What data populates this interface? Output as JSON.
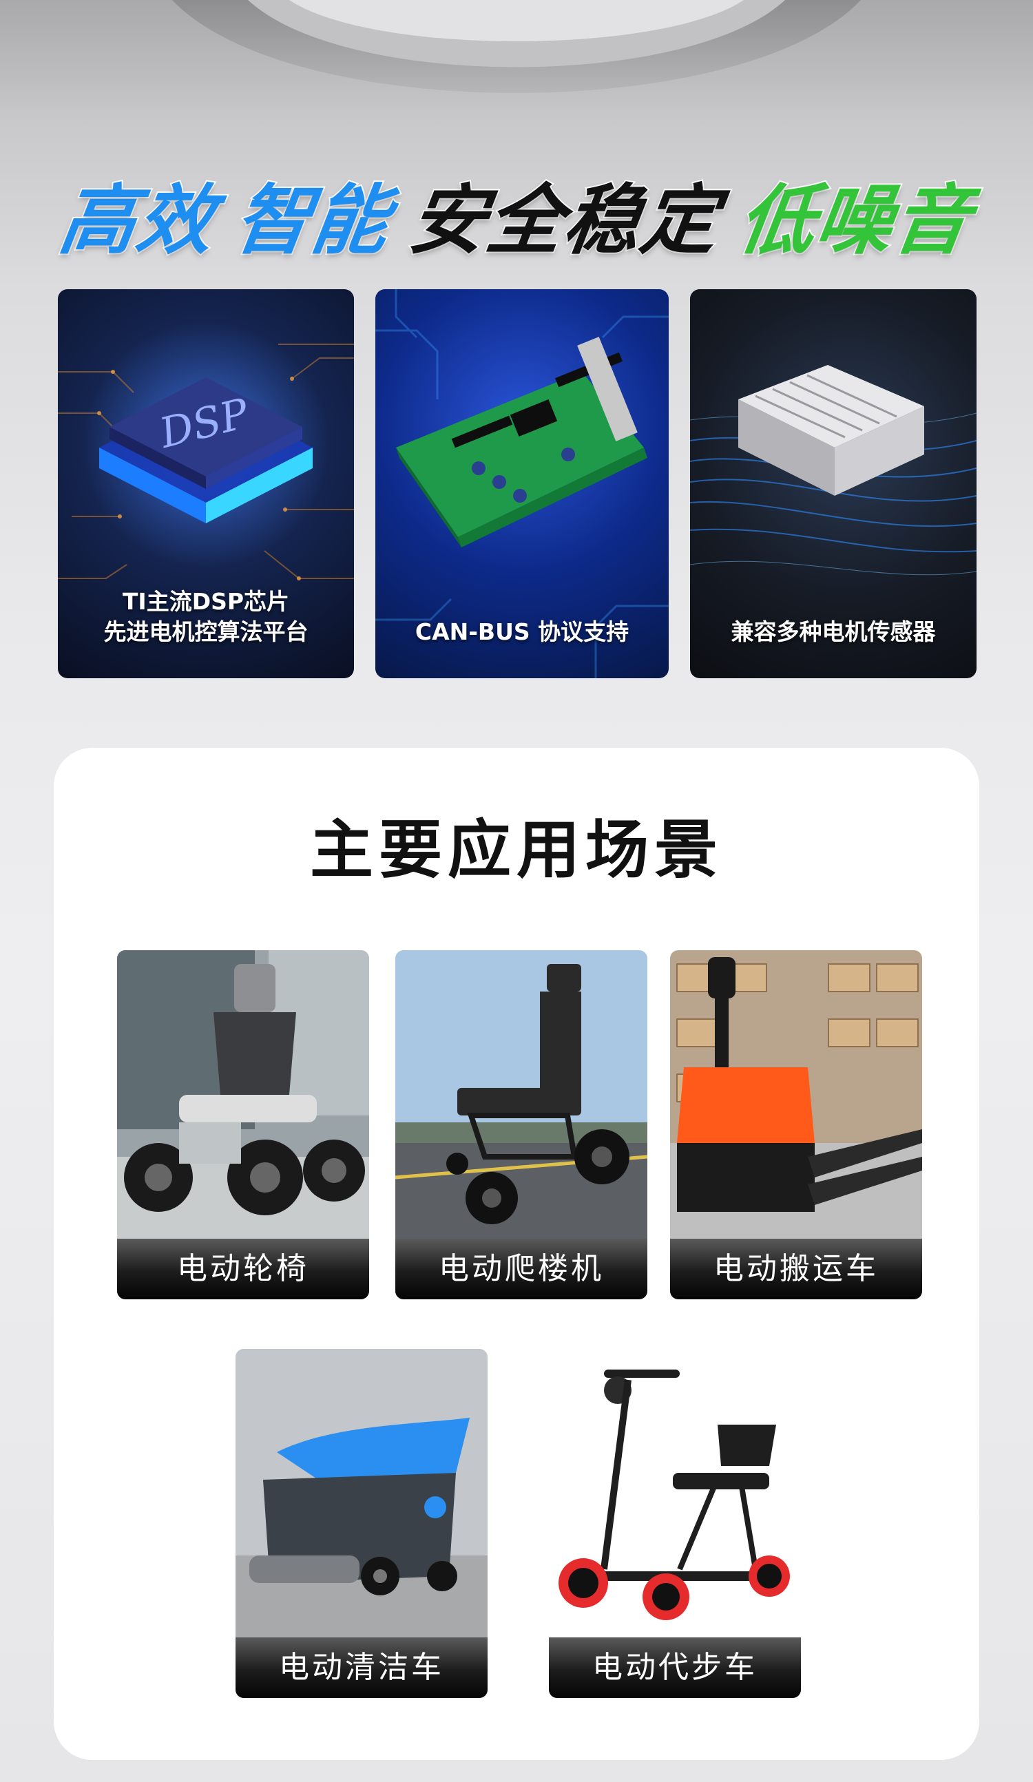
{
  "headline": {
    "word1": "高效",
    "word2": "智能",
    "word3": "安全稳定",
    "word4": "低噪音"
  },
  "features": [
    {
      "caption_line1": "TI主流DSP芯片",
      "caption_line2": "先进电机控算法平台",
      "chip_text": "DSP"
    },
    {
      "caption_line1": "CAN-BUS 协议支持"
    },
    {
      "caption_line1": "兼容多种电机传感器"
    }
  ],
  "applications": {
    "title": "主要应用场景",
    "items": [
      {
        "label": "电动轮椅"
      },
      {
        "label": "电动爬楼机"
      },
      {
        "label": "电动搬运车"
      },
      {
        "label": "电动清洁车"
      },
      {
        "label": "电动代步车"
      }
    ]
  },
  "colors": {
    "headline_blue": "#1e8ff0",
    "headline_black": "#111111",
    "headline_green": "#34c43a"
  }
}
